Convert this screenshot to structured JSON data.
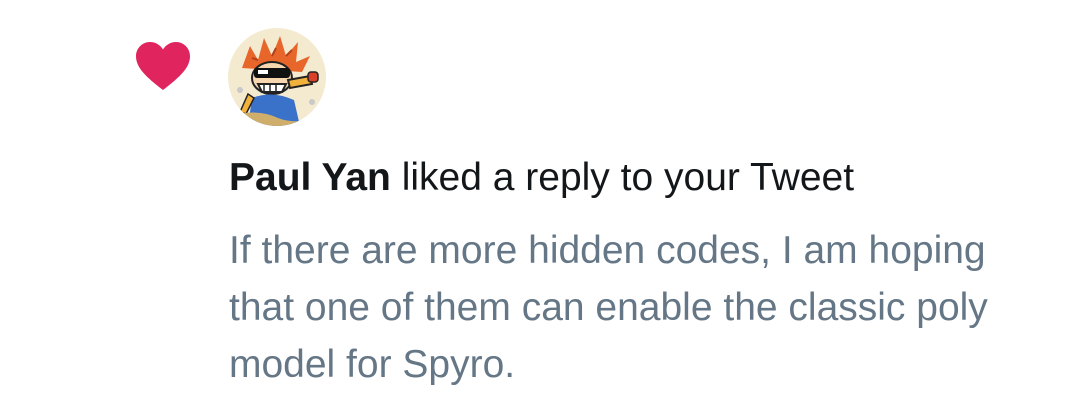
{
  "notification": {
    "type_icon": "heart-icon",
    "accent_color": "#e0245e",
    "user_name": "Paul Yan",
    "action_text": " liked a reply to your Tweet",
    "tweet_text": "If there are more hidden codes, I am hoping that one of them can enable the classic poly model for Spyro."
  }
}
